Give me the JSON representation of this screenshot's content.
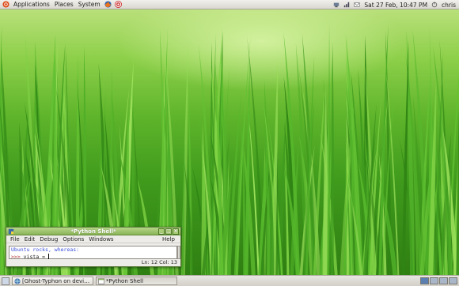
{
  "top_panel": {
    "menus": [
      "Applications",
      "Places",
      "System"
    ],
    "clock": "Sat 27 Feb, 10:47 PM",
    "user": "chris"
  },
  "python_shell": {
    "title": "*Python Shell*",
    "menu": [
      "File",
      "Edit",
      "Debug",
      "Options",
      "Windows"
    ],
    "help": "Help",
    "output_line": "Ubuntu rocks, whereas:",
    "prompt": ">>>",
    "input": " vista = ",
    "status": "Ln: 12 Col: 13",
    "controls": [
      "_",
      "□",
      "×"
    ]
  },
  "taskbar": {
    "tasks": [
      {
        "label": "[Ghost-Typhon on devi…",
        "icon": "browser-globe-icon"
      },
      {
        "label": "*Python Shell",
        "icon": "terminal-window-icon"
      }
    ]
  },
  "colors": {
    "titlebar": "#8bb458",
    "prompt": "#b23030",
    "output": "#3a4fd8"
  }
}
